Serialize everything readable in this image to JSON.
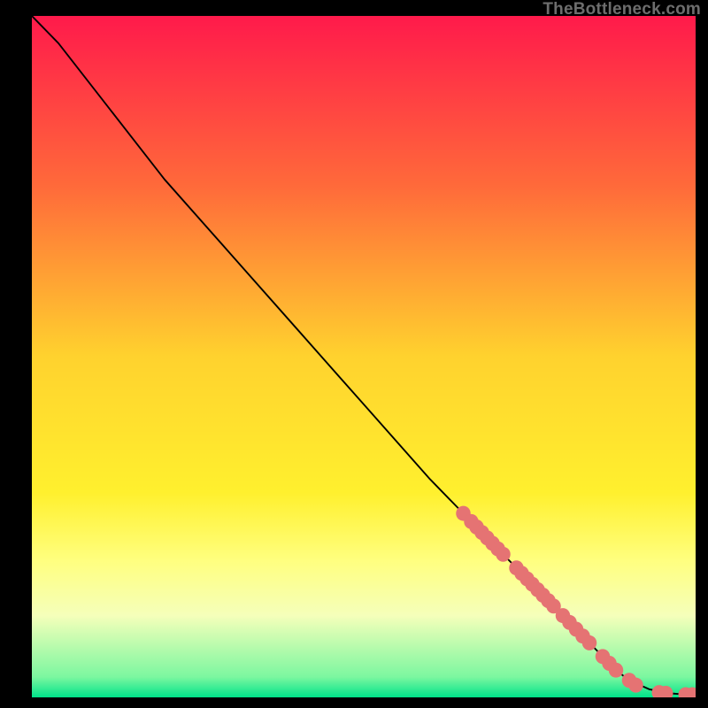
{
  "attribution": "TheBottleneck.com",
  "chart_data": {
    "type": "line",
    "title": "",
    "xlabel": "",
    "ylabel": "",
    "xlim": [
      0,
      100
    ],
    "ylim": [
      0,
      100
    ],
    "background_gradient": {
      "stops": [
        {
          "offset": 0,
          "color": "#ff1a4b"
        },
        {
          "offset": 0.25,
          "color": "#ff6a3a"
        },
        {
          "offset": 0.5,
          "color": "#ffd22e"
        },
        {
          "offset": 0.7,
          "color": "#fff02e"
        },
        {
          "offset": 0.8,
          "color": "#ffff80"
        },
        {
          "offset": 0.88,
          "color": "#f5ffba"
        },
        {
          "offset": 0.97,
          "color": "#7cf7a0"
        },
        {
          "offset": 1.0,
          "color": "#00e38a"
        }
      ]
    },
    "curve": {
      "x": [
        0,
        4,
        8,
        12,
        20,
        30,
        40,
        50,
        60,
        65,
        70,
        75,
        80,
        85,
        88,
        90,
        93,
        96,
        99,
        100
      ],
      "y": [
        100,
        96,
        91,
        86,
        76,
        65,
        54,
        43,
        32,
        27,
        22,
        17,
        12,
        7,
        4,
        2.5,
        1.2,
        0.6,
        0.4,
        0.4
      ]
    },
    "markers": {
      "color": "#e57373",
      "radius": 1.1,
      "points": [
        {
          "x": 65.0,
          "y": 27.0
        },
        {
          "x": 66.2,
          "y": 25.8
        },
        {
          "x": 67.0,
          "y": 25.0
        },
        {
          "x": 67.8,
          "y": 24.2
        },
        {
          "x": 68.6,
          "y": 23.4
        },
        {
          "x": 69.4,
          "y": 22.6
        },
        {
          "x": 70.2,
          "y": 21.8
        },
        {
          "x": 71.0,
          "y": 21.0
        },
        {
          "x": 73.0,
          "y": 19.0
        },
        {
          "x": 73.8,
          "y": 18.2
        },
        {
          "x": 74.6,
          "y": 17.4
        },
        {
          "x": 75.4,
          "y": 16.6
        },
        {
          "x": 76.2,
          "y": 15.8
        },
        {
          "x": 77.0,
          "y": 15.0
        },
        {
          "x": 77.8,
          "y": 14.2
        },
        {
          "x": 78.6,
          "y": 13.4
        },
        {
          "x": 80.0,
          "y": 12.0
        },
        {
          "x": 81.0,
          "y": 11.0
        },
        {
          "x": 82.0,
          "y": 10.0
        },
        {
          "x": 83.0,
          "y": 9.0
        },
        {
          "x": 84.0,
          "y": 8.0
        },
        {
          "x": 86.0,
          "y": 6.0
        },
        {
          "x": 87.0,
          "y": 5.0
        },
        {
          "x": 88.0,
          "y": 4.0
        },
        {
          "x": 90.0,
          "y": 2.5
        },
        {
          "x": 91.0,
          "y": 1.8
        },
        {
          "x": 94.5,
          "y": 0.7
        },
        {
          "x": 95.5,
          "y": 0.6
        },
        {
          "x": 98.5,
          "y": 0.4
        },
        {
          "x": 99.5,
          "y": 0.4
        }
      ]
    }
  }
}
